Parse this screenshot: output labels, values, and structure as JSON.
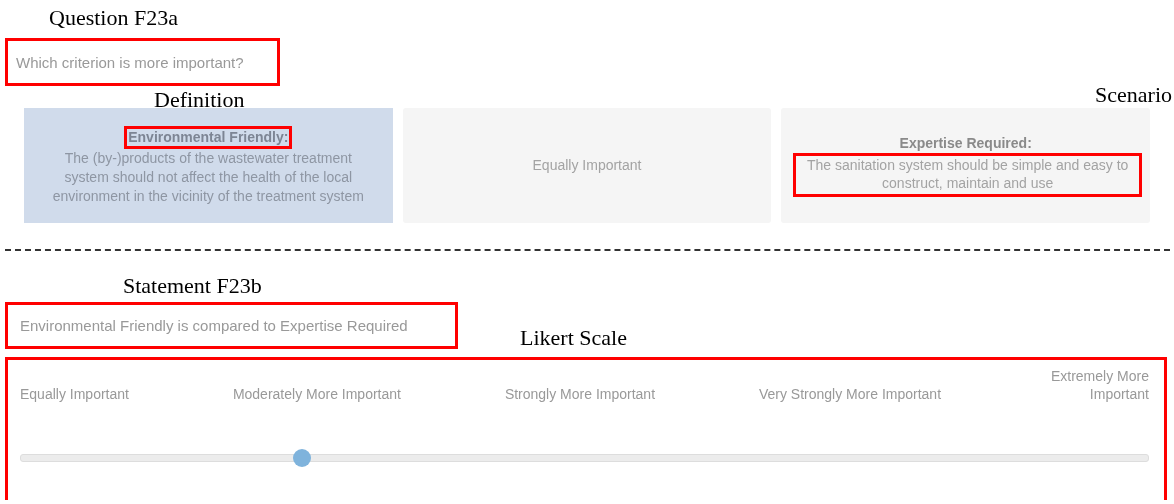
{
  "question": {
    "annotation": "Question F23a",
    "text": "Which criterion is more important?"
  },
  "cards": [
    {
      "kind": "criterion",
      "selected": true,
      "title": "Environmental Friendly:",
      "description": "The (by-)products of the wastewater treatment system should not affect the health of the local environment in the vicinity of the treatment system",
      "title_annotation": "Definition"
    },
    {
      "kind": "option",
      "selected": false,
      "label": "Equally Important"
    },
    {
      "kind": "criterion",
      "selected": false,
      "title": "Expertise Required:",
      "description": "The sanitation system should be simple and easy to construct, maintain and use",
      "description_annotation": "Scenario"
    }
  ],
  "statement": {
    "annotation": "Statement F23b",
    "text": "Environmental Friendly is compared to Expertise Required"
  },
  "likert": {
    "annotation": "Likert Scale",
    "labels": [
      "Equally Important",
      "Moderately More Important",
      "Strongly More Important",
      "Very Strongly More Important",
      "Extremely More Important"
    ],
    "level": 0.25
  }
}
